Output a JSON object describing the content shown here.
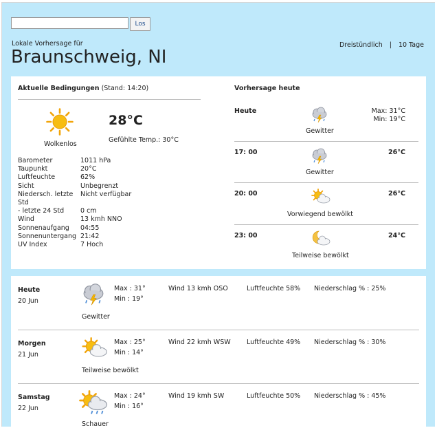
{
  "search": {
    "value": "",
    "button_label": "Los"
  },
  "header": {
    "subtitle": "Lokale Vorhersage für",
    "city": "Braunschweig, NI",
    "view_links": [
      "Dreistündlich",
      "10 Tage"
    ],
    "separator": "|"
  },
  "current": {
    "title": "Aktuelle Bedingungen",
    "stand": "(Stand: 14:20)",
    "condition": "Wolkenlos",
    "icon": "sun-icon",
    "temperature": "28°C",
    "feels_like": "Gefühlte Temp.: 30°C",
    "details": [
      {
        "label": "Barometer",
        "value": "1011 hPa"
      },
      {
        "label": "Taupunkt",
        "value": "20°C"
      },
      {
        "label": "Luftfeuchte",
        "value": "62%"
      },
      {
        "label": "Sicht",
        "value": "Unbegrenzt"
      },
      {
        "label": "Niedersch. letzte",
        "value": "Nicht verfügbar"
      },
      {
        "label": "Std",
        "value": ""
      },
      {
        "label": "- letzte 24 Std",
        "value": "0 cm"
      },
      {
        "label": "Wind",
        "value": "13 kmh NNO"
      },
      {
        "label": "Sonnenaufgang",
        "value": "04:55"
      },
      {
        "label": "Sonnenuntergang",
        "value": "21:42"
      },
      {
        "label": "UV Index",
        "value": "7 Hoch"
      }
    ]
  },
  "today": {
    "title": "Vorhersage heute",
    "rows": [
      {
        "time": "Heute",
        "condition": "Gewitter",
        "icon": "thunderstorm-icon",
        "max": "Max: 31°C",
        "min": "Min: 19°C"
      },
      {
        "time": "17: 00",
        "condition": "Gewitter",
        "icon": "thunderstorm-icon",
        "temp": "26°C"
      },
      {
        "time": "20: 00",
        "condition": "Vorwiegend bewölkt",
        "icon": "sun-cloud-icon",
        "temp": "26°C"
      },
      {
        "time": "23: 00",
        "condition": "Teilweise bewölkt",
        "icon": "moon-cloud-icon",
        "temp": "24°C"
      }
    ]
  },
  "daily": [
    {
      "day": "Heute",
      "date": "20 Jun",
      "condition": "Gewitter",
      "icon": "thunderstorm-icon",
      "max": "Max : 31°",
      "min": "Min : 19°",
      "wind": "Wind 13 kmh OSO",
      "humidity": "Luftfeuchte 58%",
      "precip": "Niederschlag % : 25%"
    },
    {
      "day": "Morgen",
      "date": "21 Jun",
      "condition": "Teilweise bewölkt",
      "icon": "sun-cloud-icon",
      "max": "Max : 25°",
      "min": "Min : 14°",
      "wind": "Wind 22 kmh WSW",
      "humidity": "Luftfeuchte 49%",
      "precip": "Niederschlag % : 30%"
    },
    {
      "day": "Samstag",
      "date": "22 Jun",
      "condition": "Schauer",
      "icon": "sun-rain-icon",
      "max": "Max : 24°",
      "min": "Min : 16°",
      "wind": "Wind 19 kmh SW",
      "humidity": "Luftfeuchte 50%",
      "precip": "Niederschlag % : 45%"
    }
  ]
}
